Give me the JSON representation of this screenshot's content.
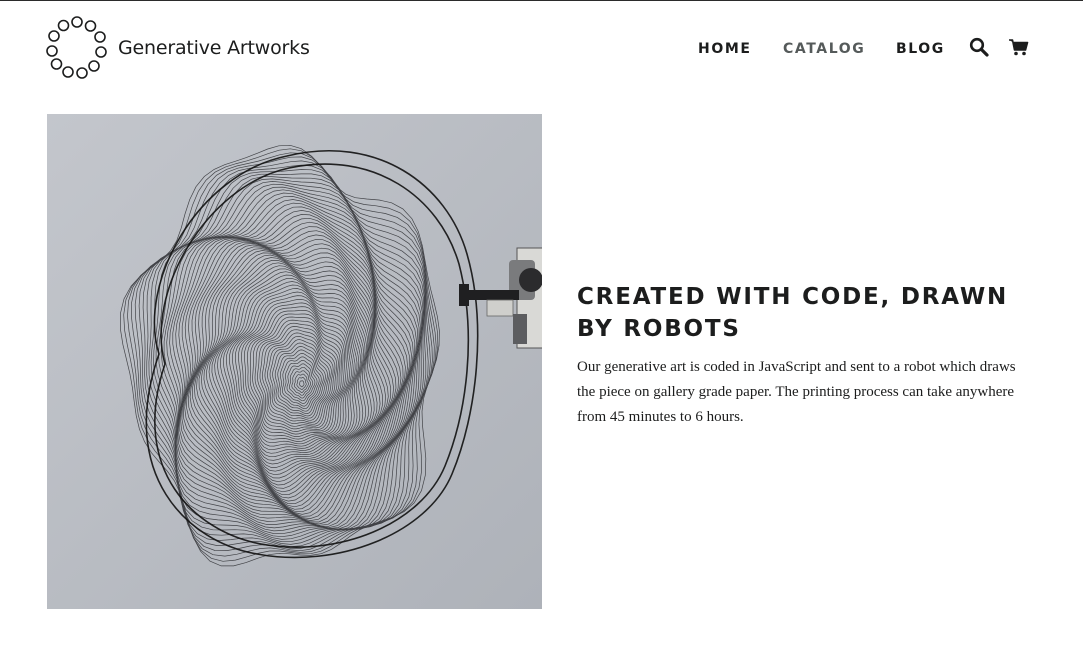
{
  "header": {
    "logo_text": "Generative Artworks",
    "logo_icon": "ring-of-circles-logo",
    "nav": [
      {
        "label": "HOME"
      },
      {
        "label": "CATALOG"
      },
      {
        "label": "BLOG"
      }
    ],
    "search_icon": "search-icon",
    "cart_icon": "cart-icon"
  },
  "feature": {
    "image_alt_icon": "plotter-drawing-image",
    "heading": "CREATED WITH CODE, DRAWN BY ROBOTS",
    "body": "Our generative art is coded in JavaScript and sent to a robot which draws the piece on gallery grade paper. The printing process can take anywhere from 45 minutes to 6 hours."
  },
  "colors": {
    "text": "#1c1d1d",
    "muted_nav": "#555a5a",
    "image_background": "#b8bcc3"
  }
}
